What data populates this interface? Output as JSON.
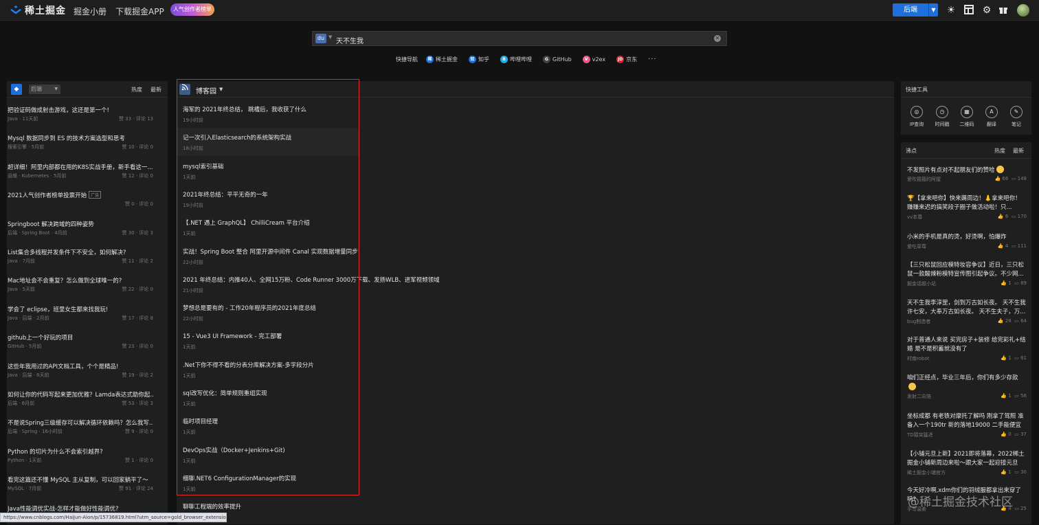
{
  "topbar": {
    "logo_text": "稀土掘金",
    "nav": [
      "掘金小册",
      "下载掘金APP"
    ],
    "badge_text": "人气创作者榜单",
    "category_select": "后端",
    "icons": [
      "sun-icon",
      "layout-icon",
      "gear-icon",
      "gift-icon",
      "avatar"
    ]
  },
  "search": {
    "engine_icon": "baidu-icon",
    "value": "天不生我"
  },
  "quick_nav": {
    "label": "快捷导航",
    "items": [
      {
        "label": "稀土掘金",
        "color": "#1e6fd9",
        "glyph": "稀"
      },
      {
        "label": "知乎",
        "color": "#1a6ed8",
        "glyph": "知"
      },
      {
        "label": "哔哩哔哩",
        "color": "#23ade5",
        "glyph": "B"
      },
      {
        "label": "GitHub",
        "color": "#444444",
        "glyph": "G"
      },
      {
        "label": "v2ex",
        "color": "#e85a8c",
        "glyph": "V"
      },
      {
        "label": "京东",
        "color": "#d9232d",
        "glyph": "JD"
      }
    ],
    "more": "···"
  },
  "left_panel": {
    "category": "后端",
    "tabs": [
      "热度",
      "最新"
    ],
    "articles": [
      {
        "title": "把验证码做成射击游戏，这还是第一个!",
        "meta": "Java · 11天前",
        "stats": "赞 33 · 评论 13"
      },
      {
        "title": "Mysql 数据同步到 ES 的技术方案选型和思考",
        "meta": "搜索引擎 · 5月前",
        "stats": "赞 10 · 评论 0"
      },
      {
        "title": "超详细！阿里内部都在用的K8S实战手册，新手看这一...",
        "meta": "运维 · Kubernetes · 5月前",
        "stats": "赞 12 · 评论 0"
      },
      {
        "title": "2021人气创作者榜单投票开始",
        "ad": "广告",
        "meta": "",
        "stats": "赞 0 · 评论 0"
      },
      {
        "title": "Springboot 解决跨域的四种姿势",
        "meta": "后端 · Spring Boot · 4月前",
        "stats": "赞 30 · 评论 3"
      },
      {
        "title": "List集合多线程并发条件下不安全，如何解决?",
        "meta": "Java · 7月前",
        "stats": "赞 11 · 评论 2"
      },
      {
        "title": "Mac地址会不会重复？怎么做到全球唯一的?",
        "meta": "Java · 5天前",
        "stats": "赞 22 · 评论 0"
      },
      {
        "title": "学会了 eclipse，班里女生都来找我玩!",
        "meta": "Java · 后端 · 2月前",
        "stats": "赞 17 · 评论 8"
      },
      {
        "title": "github上一个好玩的项目",
        "meta": "GitHub · 5月前",
        "stats": "赞 23 · 评论 0"
      },
      {
        "title": "这些年我用过的API文档工具，个个是精品!",
        "meta": "Java · 后端 · 6天前",
        "stats": "赞 19 · 评论 2"
      },
      {
        "title": "如何让你的代码写起来更加优雅？Lamda表达式助你起...",
        "meta": "后端 · 6月前",
        "stats": "赞 53 · 评论 3"
      },
      {
        "title": "不是说Spring三级缓存可以解决循环依赖吗？怎么我写...",
        "meta": "后端 · Spring · 16小时前",
        "stats": "赞 9 · 评论 0"
      },
      {
        "title": "Python 的切片为什么不会索引越界?",
        "meta": "Python · 1天前",
        "stats": "赞 1 · 评论 0"
      },
      {
        "title": "看完这篇还不懂 MySQL 主从复制，可以回家躺平了～",
        "meta": "MySQL · 7月前",
        "stats": "赞 91 · 评论 24"
      },
      {
        "title": "Java性能调优实战-怎样才能做好性能调优?",
        "meta": "",
        "stats": ""
      }
    ]
  },
  "center_panel": {
    "source": "博客园",
    "articles": [
      {
        "title": "海军的 2021年终总结， 跳槽后，我收获了什么",
        "time": "19小时前"
      },
      {
        "title": "记一次引入Elasticsearch的系统架构实战",
        "time": "18小时前"
      },
      {
        "title": "mysql索引基础",
        "time": "1天前"
      },
      {
        "title": "2021年终总结：平平无奇的一年",
        "time": "19小时前"
      },
      {
        "title": "【.NET 遇上 GraphQL】 ChilliCream 平台介绍",
        "time": "1天前"
      },
      {
        "title": "实战！Spring Boot 整合 阿里开源中间件 Canal 实现数据增量同步!",
        "time": "22小时前"
      },
      {
        "title": "2021 年终总结：内推40人、全网15万粉、Code Runner 3000万下载、发扬WLB、进军视频领域",
        "time": "21小时前"
      },
      {
        "title": "梦想总是要有的 - 工作20年程序员的2021年度总结",
        "time": "22小时前"
      },
      {
        "title": "15 - Vue3 UI Framework - 完工部署",
        "time": "1天前"
      },
      {
        "title": ".Net下你不得不看的分表分库解决方案-多字段分片",
        "time": "1天前"
      },
      {
        "title": "sql改写优化：简单规则重组实现",
        "time": "1天前"
      },
      {
        "title": "临时项目经理",
        "time": "1天前"
      },
      {
        "title": "DevOps实战（Docker+Jenkins+Git)",
        "time": "1天前"
      },
      {
        "title": "细聊.NET6 ConfigurationManager的实现",
        "time": "1天前"
      },
      {
        "title": "聊聊工程端的效率提升",
        "time": ""
      }
    ]
  },
  "tools_panel": {
    "title": "快捷工具",
    "tools": [
      {
        "label": "IP查询",
        "glyph": "◎"
      },
      {
        "label": "时间戳",
        "glyph": "◷"
      },
      {
        "label": "二维码",
        "glyph": "▦"
      },
      {
        "label": "翻译",
        "glyph": "A"
      },
      {
        "label": "笔记",
        "glyph": "✎"
      }
    ]
  },
  "hot_panel": {
    "title": "沸点",
    "tabs": [
      "热度",
      "最新"
    ],
    "items": [
      {
        "text": "不发照片有点对不起朋友们的赞哈",
        "emoji": true,
        "user": "爱吹箍箍的阿猩",
        "likes": "66",
        "comments": "148"
      },
      {
        "text": "🏆【拿来吧你】快来薅周边！👃拿来吧你！赚赚来迟的搞笑段子圈子做活动啦！只...",
        "user": "vv本尊",
        "likes": "6",
        "comments": "170"
      },
      {
        "text": "小米的手机是真的烫，好烫啊，怕爆炸",
        "user": "爱吃草莓",
        "likes": "4",
        "comments": "111"
      },
      {
        "text": "【三只松鼠回应模特妆容争议】近日，三只松鼠一款酸辣粉模特宣传图引起争议。不少网...",
        "user": "掘金话题小站",
        "likes": "1",
        "comments": "89"
      },
      {
        "text": "天不生我李淳罡，剑到万古如长夜。 天不生我许七安，大奉万古如长夜。 天不生夫子，万...",
        "user": "bug制造者",
        "likes": "28",
        "comments": "64"
      },
      {
        "text": "对于普通人来说 买完房子+装修 给完彩礼+结婚 是不是积蓄就没有了",
        "user": "村南robot",
        "likes": "1",
        "comments": "61"
      },
      {
        "text": "咱们正经点，毕业三年后，你们有多少存款",
        "emoji": true,
        "user": "发射二向箔",
        "likes": "1",
        "comments": "56"
      },
      {
        "text": "坐标成都 有老铁对摩托了解吗 刚拿了驾照 准备入一个190tr 新的落地19000 二手能便宜不少 ...",
        "user": "TD猿突猛进",
        "likes": "0",
        "comments": "37"
      },
      {
        "text": "【小铺元旦上新】2021即将落幕，2022稀土掘金小铺新周边来啦～跟大家一起迎接元旦 🎈...",
        "user": "稀土掘金小铺官方",
        "likes": "1",
        "comments": "30"
      },
      {
        "text": "今天好冷啊,xdm你们的羽绒服都拿出来穿了吗?",
        "user": "手写温柔",
        "likes": "4",
        "comments": "25"
      }
    ]
  },
  "status_url": "https://www.cnblogs.com/HaiJun-Aion/p/15736819.html?utm_source=gold_browser_extension",
  "watermark": "@稀土掘金技术社区"
}
